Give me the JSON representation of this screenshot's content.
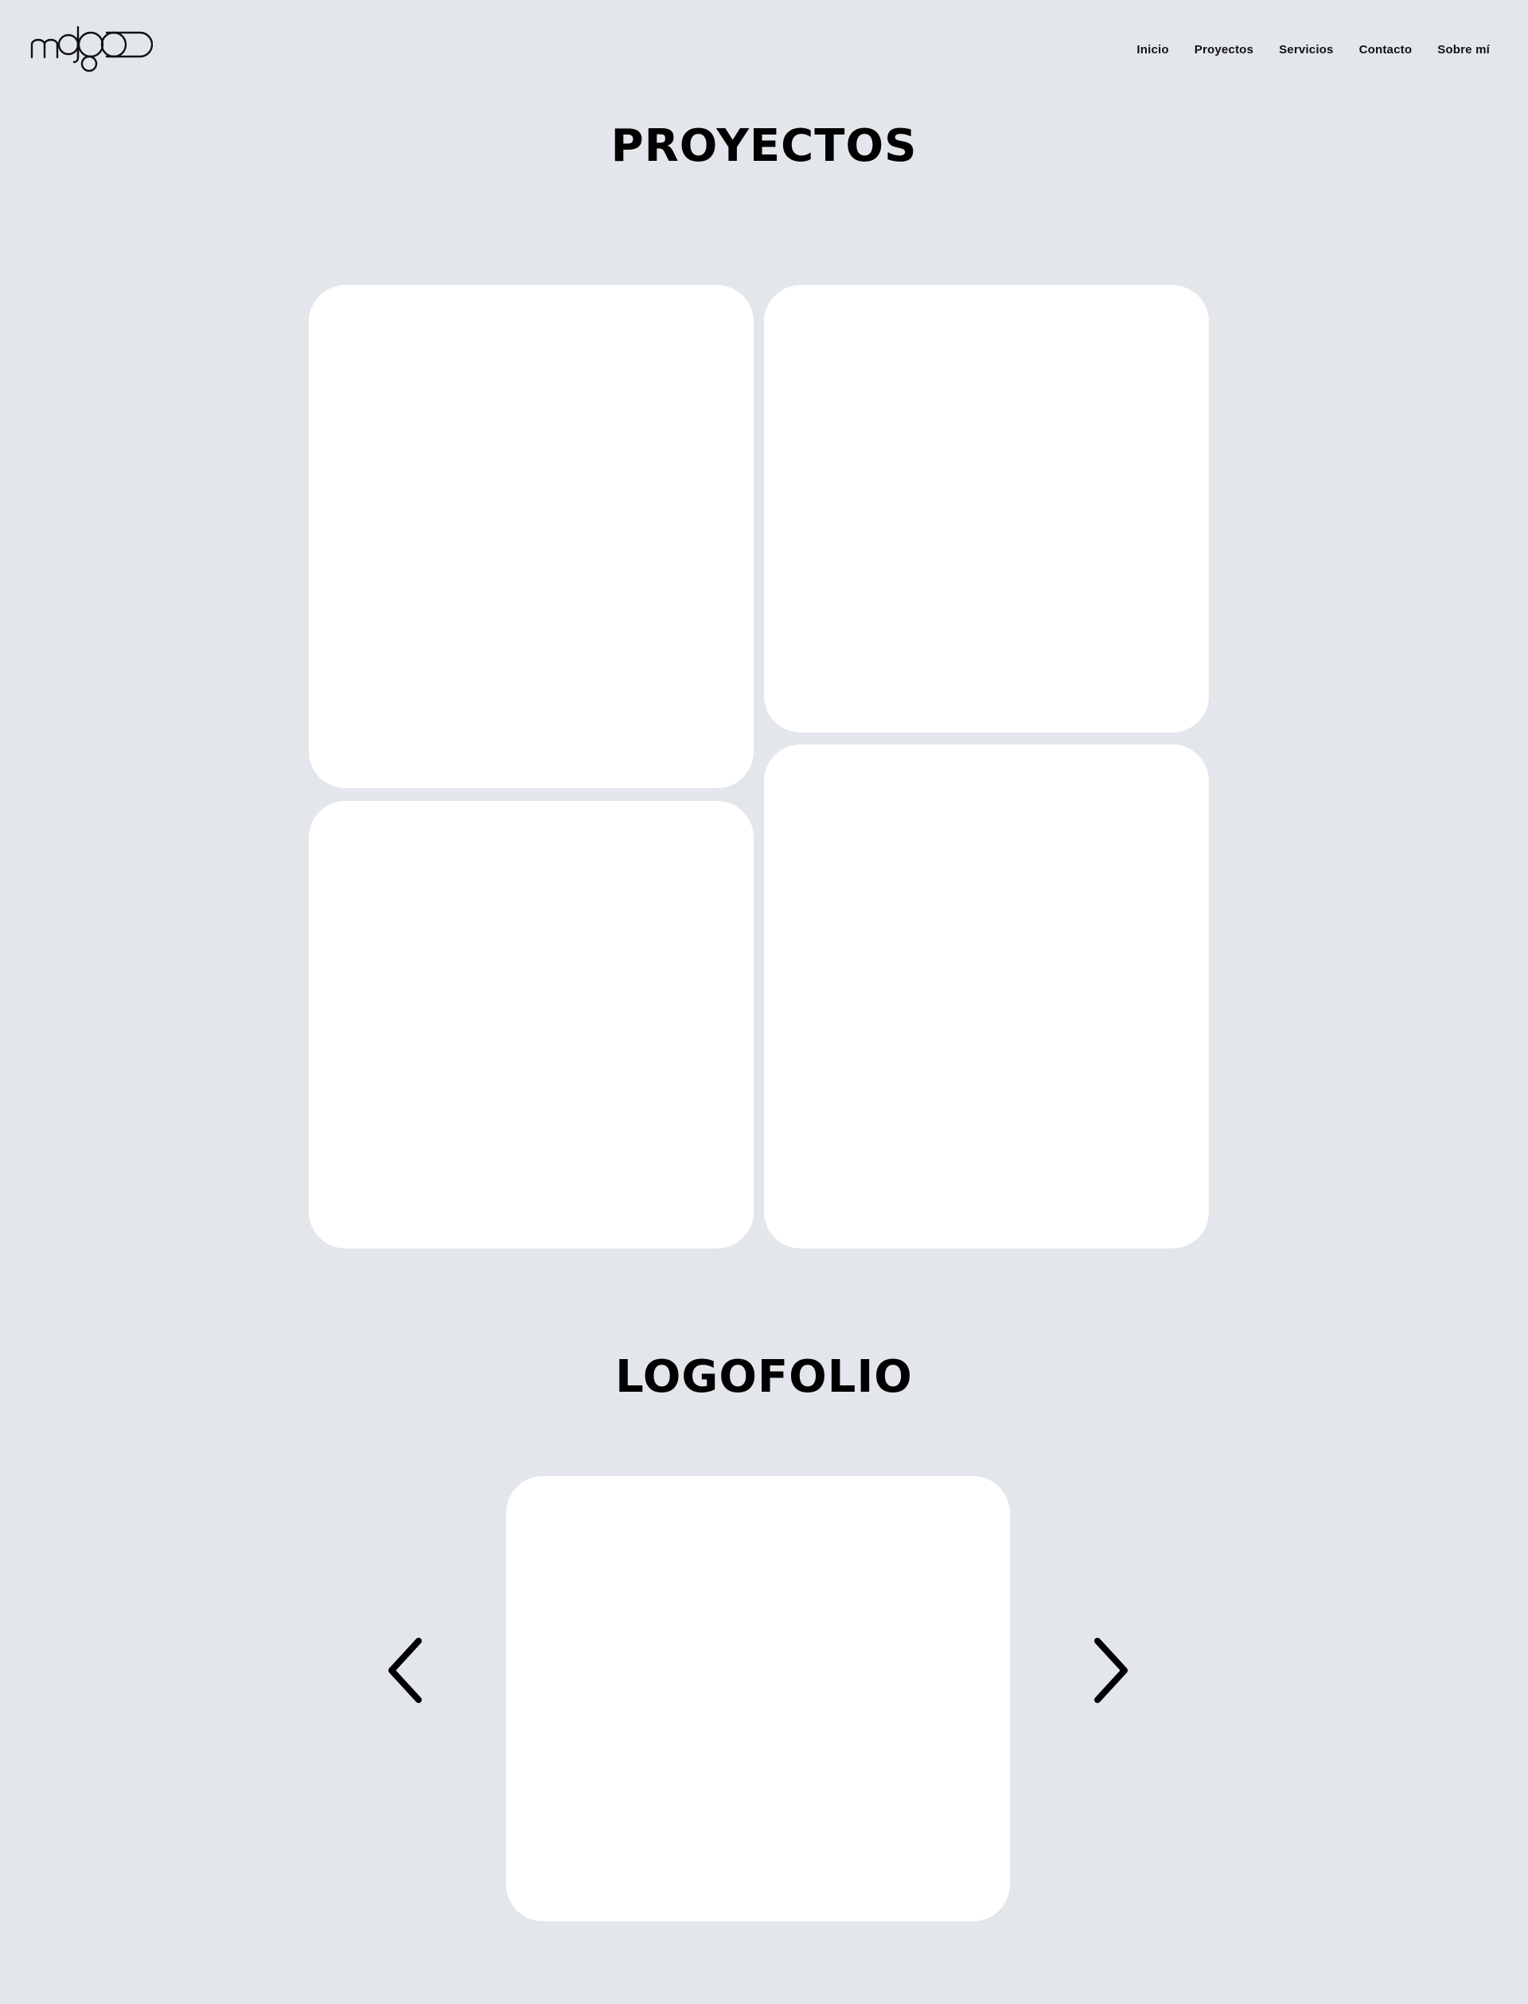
{
  "header": {
    "logo_icon": "mgbo-logo",
    "nav": [
      {
        "label": "Inicio"
      },
      {
        "label": "Proyectos"
      },
      {
        "label": "Servicios"
      },
      {
        "label": "Contacto"
      },
      {
        "label": "Sobre mí"
      }
    ]
  },
  "projects": {
    "title": "PROYECTOS"
  },
  "logofolio": {
    "title": "LOGOFOLIO",
    "prev_icon": "chevron-left-icon",
    "next_icon": "chevron-right-icon"
  },
  "colors": {
    "background": "#e3e6eb",
    "card": "#ffffff",
    "text": "#000000"
  }
}
